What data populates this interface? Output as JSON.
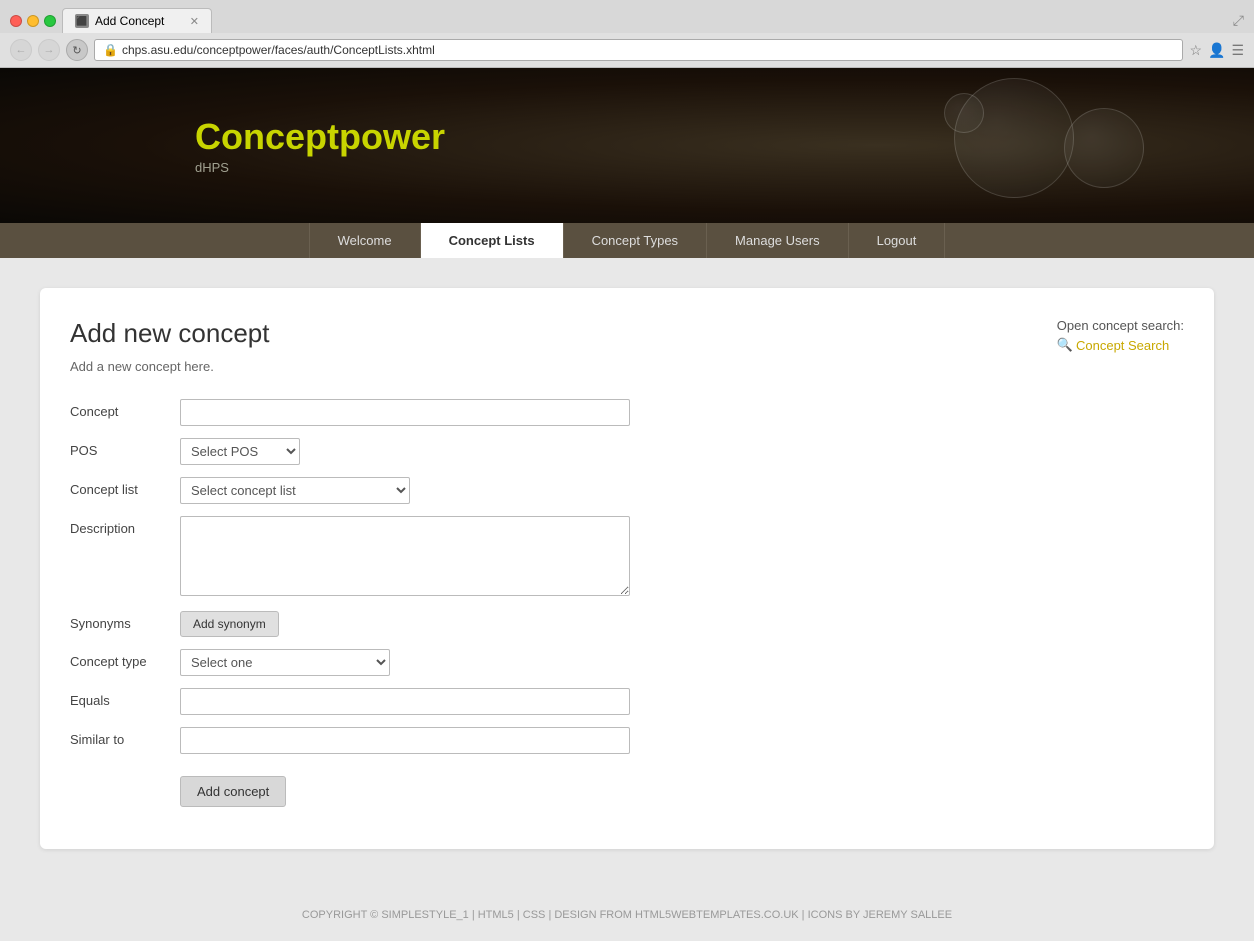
{
  "browser": {
    "tab_title": "Add Concept",
    "url": "chps.asu.edu/conceptpower/faces/auth/ConceptLists.xhtml",
    "back_btn": "←",
    "forward_btn": "→",
    "refresh_btn": "↻"
  },
  "header": {
    "logo_plain": "Concept",
    "logo_accent": "power",
    "sub": "dHPS"
  },
  "nav": {
    "items": [
      {
        "label": "Welcome",
        "active": false
      },
      {
        "label": "Concept Lists",
        "active": true
      },
      {
        "label": "Concept Types",
        "active": false
      },
      {
        "label": "Manage Users",
        "active": false
      },
      {
        "label": "Logout",
        "active": false
      }
    ]
  },
  "main": {
    "title": "Add new concept",
    "subtitle": "Add a new concept here.",
    "concept_search": {
      "label": "Open concept search:",
      "link_text": "Concept Search"
    },
    "form": {
      "concept_label": "Concept",
      "pos_label": "POS",
      "pos_placeholder": "Select POS",
      "concept_list_label": "Concept list",
      "concept_list_placeholder": "Select concept list",
      "description_label": "Description",
      "synonyms_label": "Synonyms",
      "add_synonym_btn": "Add synonym",
      "concept_type_label": "Concept type",
      "concept_type_placeholder": "Select one",
      "equals_label": "Equals",
      "similar_to_label": "Similar to",
      "add_concept_btn": "Add concept"
    }
  },
  "footer": {
    "text": "COPYRIGHT © SIMPLESTYLE_1 | HTML5 | CSS | DESIGN FROM HTML5WEBTEMPLATES.CO.UK | ICONS BY JEREMY SALLEE"
  }
}
